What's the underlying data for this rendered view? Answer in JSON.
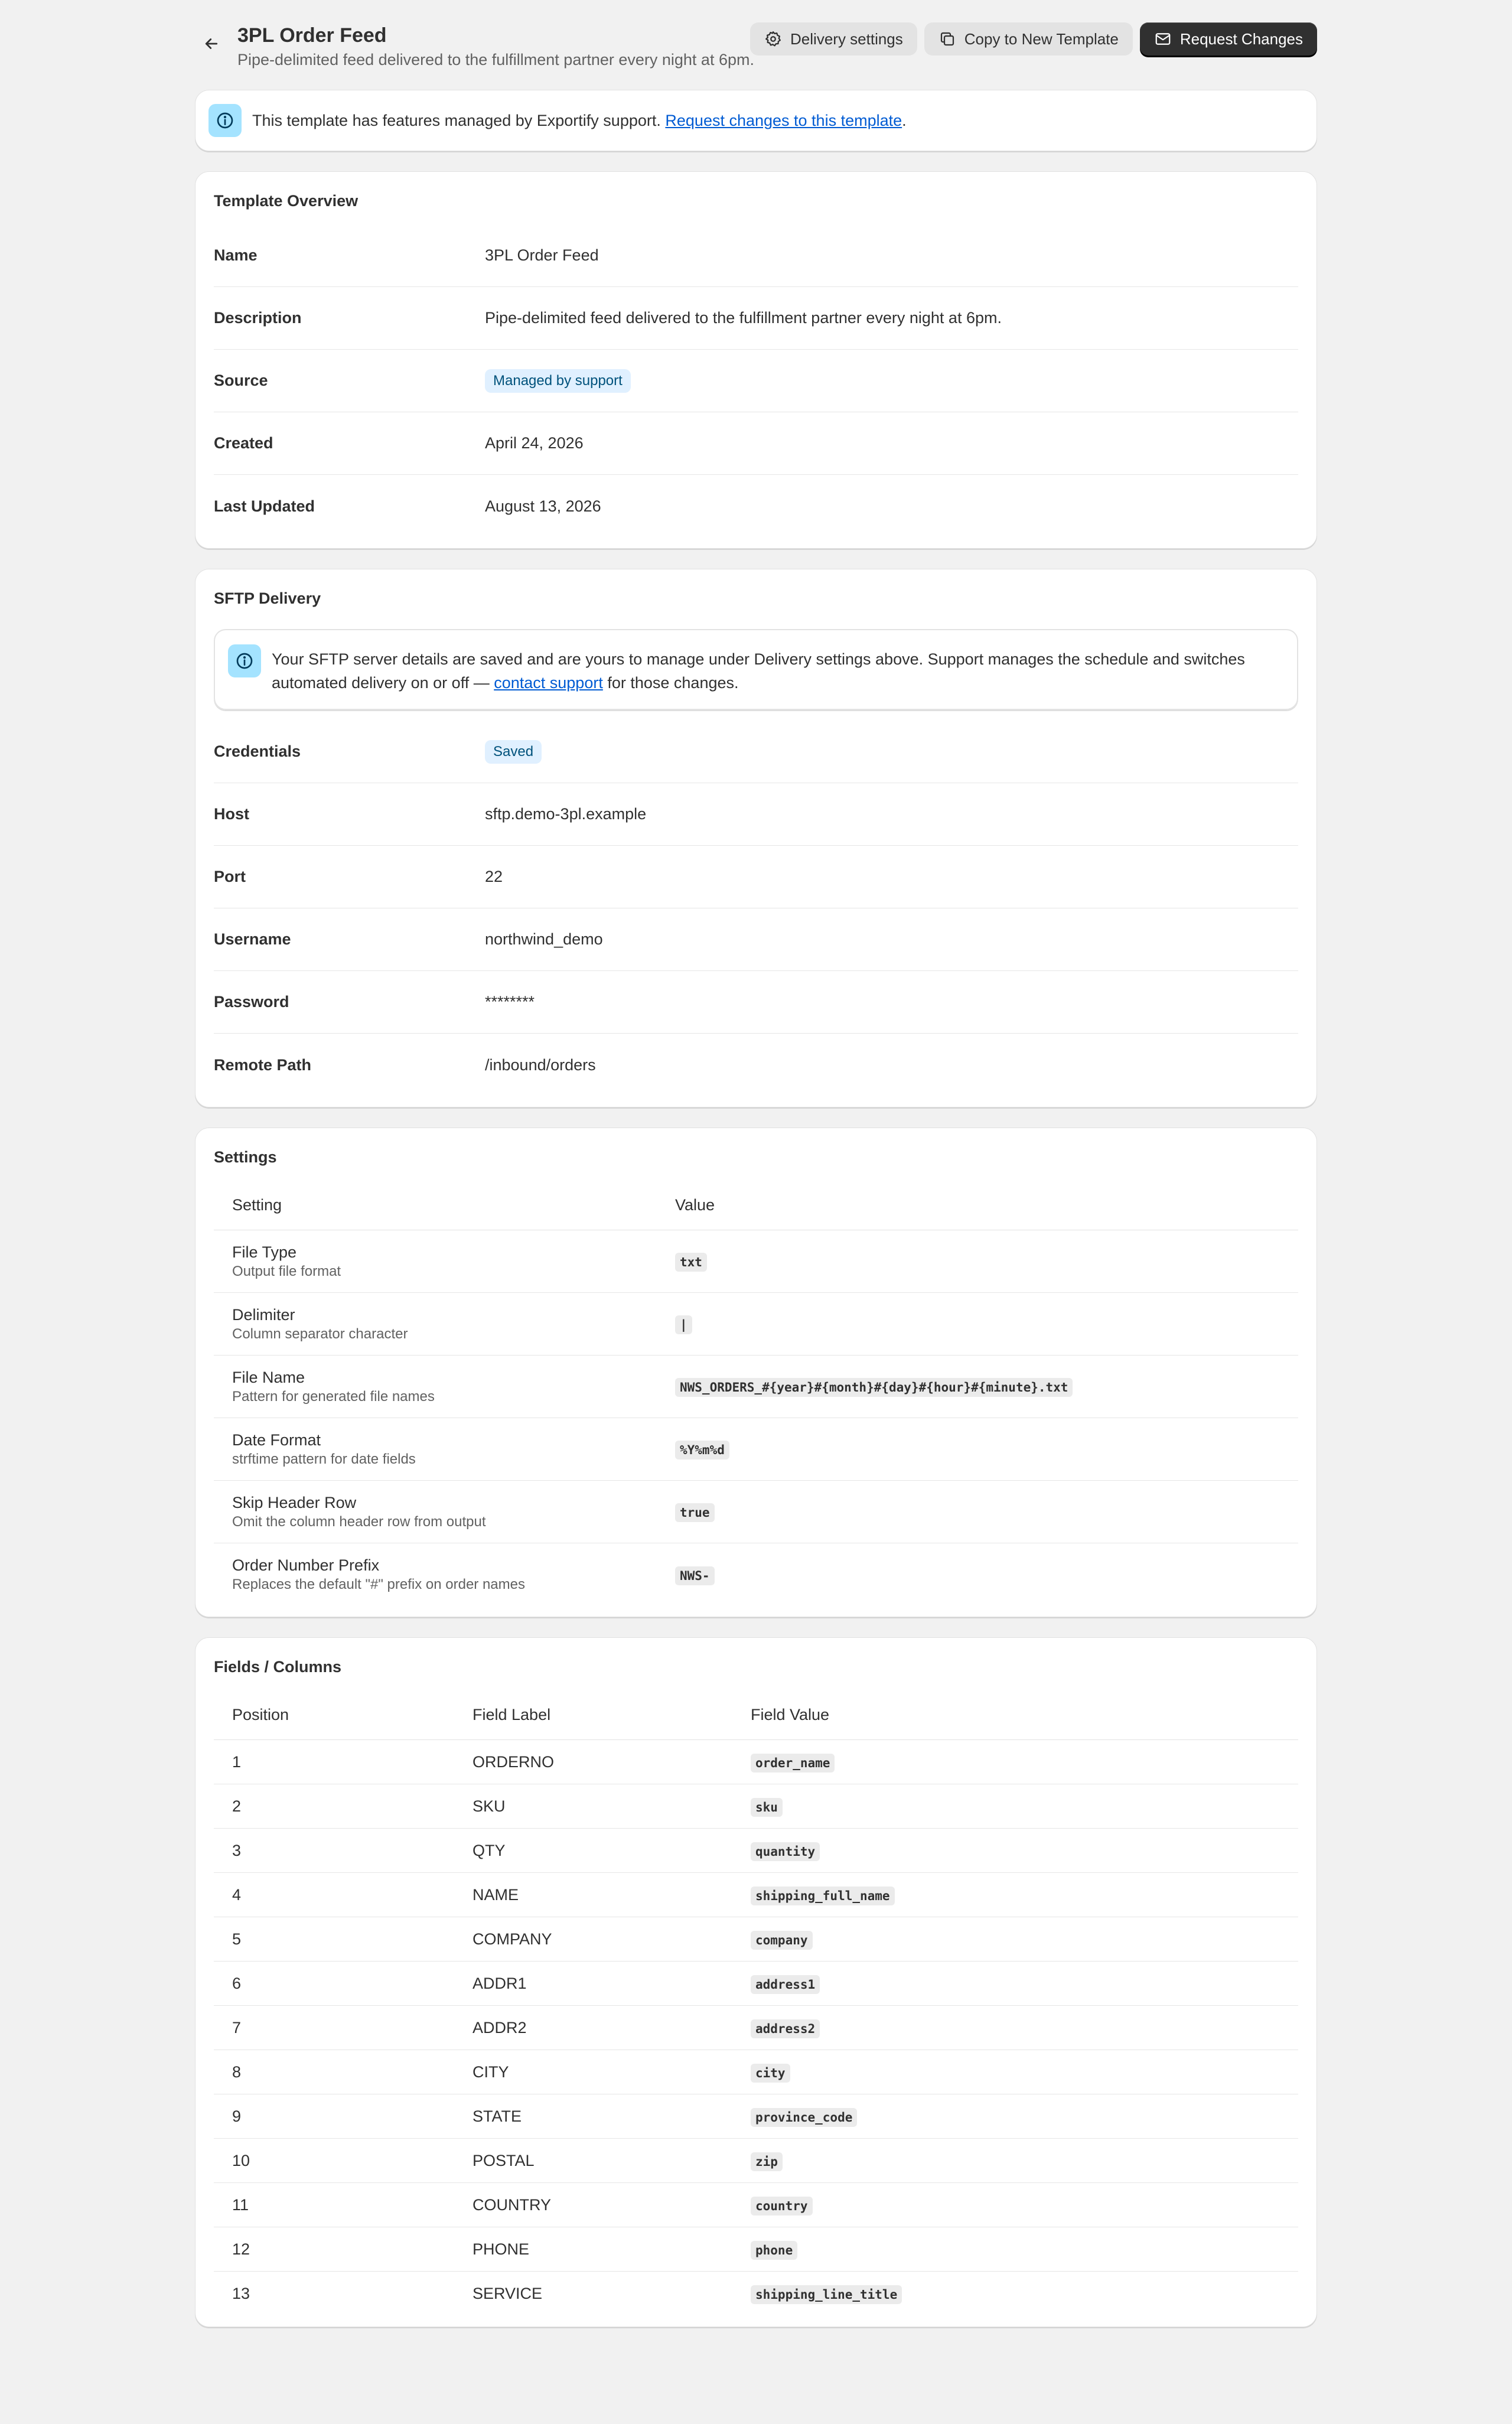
{
  "header": {
    "title": "3PL Order Feed",
    "subtitle": "Pipe-delimited feed delivered to the fulfillment partner every night at 6pm.",
    "actions": {
      "delivery_settings": "Delivery settings",
      "copy_template": "Copy to New Template",
      "request_changes": "Request Changes"
    }
  },
  "banner": {
    "text": "This template has features managed by Exportify support.",
    "link": "Request changes to this template",
    "suffix": "."
  },
  "overview": {
    "title": "Template Overview",
    "rows": [
      {
        "label": "Name",
        "value": "3PL Order Feed"
      },
      {
        "label": "Description",
        "value": "Pipe-delimited feed delivered to the fulfillment partner every night at 6pm."
      },
      {
        "label": "Source",
        "value": "Managed by support"
      },
      {
        "label": "Created",
        "value": "April 24, 2026"
      },
      {
        "label": "Last Updated",
        "value": "August 13, 2026"
      }
    ]
  },
  "sftp": {
    "title": "SFTP Delivery",
    "notice_before": "Your SFTP server details are saved and are yours to manage under Delivery settings above. Support manages the schedule and switches automated delivery on or off — ",
    "notice_link": "contact support",
    "notice_after": " for those changes.",
    "rows": [
      {
        "label": "Credentials",
        "value": "Saved"
      },
      {
        "label": "Host",
        "value": "sftp.demo-3pl.example"
      },
      {
        "label": "Port",
        "value": "22"
      },
      {
        "label": "Username",
        "value": "northwind_demo"
      },
      {
        "label": "Password",
        "value": "********"
      },
      {
        "label": "Remote Path",
        "value": "/inbound/orders"
      }
    ]
  },
  "settings": {
    "title": "Settings",
    "columns": [
      "Setting",
      "Value"
    ],
    "rows": [
      {
        "name": "File Type",
        "desc": "Output file format",
        "value": "txt"
      },
      {
        "name": "Delimiter",
        "desc": "Column separator character",
        "value": "|"
      },
      {
        "name": "File Name",
        "desc": "Pattern for generated file names",
        "value": "NWS_ORDERS_#{year}#{month}#{day}#{hour}#{minute}.txt"
      },
      {
        "name": "Date Format",
        "desc": "strftime pattern for date fields",
        "value": "%Y%m%d"
      },
      {
        "name": "Skip Header Row",
        "desc": "Omit the column header row from output",
        "value": "true"
      },
      {
        "name": "Order Number Prefix",
        "desc": "Replaces the default \"#\" prefix on order names",
        "value": "NWS-"
      }
    ]
  },
  "fields": {
    "title": "Fields / Columns",
    "columns": [
      "Position",
      "Field Label",
      "Field Value"
    ],
    "rows": [
      {
        "pos": "1",
        "label": "ORDERNO",
        "value": "order_name"
      },
      {
        "pos": "2",
        "label": "SKU",
        "value": "sku"
      },
      {
        "pos": "3",
        "label": "QTY",
        "value": "quantity"
      },
      {
        "pos": "4",
        "label": "NAME",
        "value": "shipping_full_name"
      },
      {
        "pos": "5",
        "label": "COMPANY",
        "value": "company"
      },
      {
        "pos": "6",
        "label": "ADDR1",
        "value": "address1"
      },
      {
        "pos": "7",
        "label": "ADDR2",
        "value": "address2"
      },
      {
        "pos": "8",
        "label": "CITY",
        "value": "city"
      },
      {
        "pos": "9",
        "label": "STATE",
        "value": "province_code"
      },
      {
        "pos": "10",
        "label": "POSTAL",
        "value": "zip"
      },
      {
        "pos": "11",
        "label": "COUNTRY",
        "value": "country"
      },
      {
        "pos": "12",
        "label": "PHONE",
        "value": "phone"
      },
      {
        "pos": "13",
        "label": "SERVICE",
        "value": "shipping_line_title"
      }
    ]
  }
}
